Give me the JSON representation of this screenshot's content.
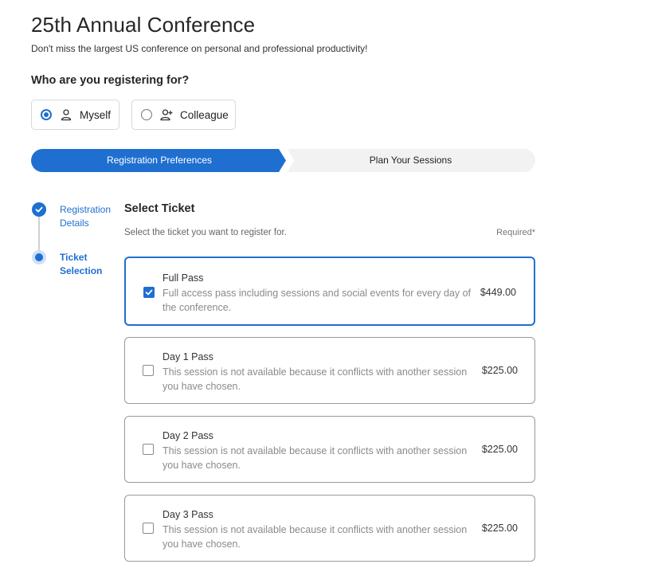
{
  "header": {
    "title": "25th Annual Conference",
    "subtitle": "Don't miss the largest US conference on personal and professional productivity!"
  },
  "who": {
    "question": "Who are you registering for?",
    "options": [
      {
        "label": "Myself",
        "icon": "person-icon",
        "selected": true
      },
      {
        "label": "Colleague",
        "icon": "person-add-icon",
        "selected": false
      }
    ]
  },
  "stepper": {
    "steps": [
      {
        "label": "Registration Preferences",
        "active": true
      },
      {
        "label": "Plan Your Sessions",
        "active": false
      }
    ]
  },
  "sidebar": {
    "steps": [
      {
        "label": "Registration Details",
        "status": "completed"
      },
      {
        "label": "Ticket Selection",
        "status": "current"
      }
    ]
  },
  "tickets": {
    "title": "Select Ticket",
    "hint": "Select the ticket you want to register for.",
    "required_label": "Required*",
    "items": [
      {
        "name": "Full Pass",
        "description": "Full access pass including sessions and social events for every day of the conference.",
        "price": "$449.00",
        "checked": true
      },
      {
        "name": "Day 1 Pass",
        "description": "This session is not available because it conflicts with another session you have chosen.",
        "price": "$225.00",
        "checked": false
      },
      {
        "name": "Day 2 Pass",
        "description": "This session is not available because it conflicts with another session you have chosen.",
        "price": "$225.00",
        "checked": false
      },
      {
        "name": "Day 3 Pass",
        "description": "This session is not available because it conflicts with another session you have chosen.",
        "price": "$225.00",
        "checked": false
      }
    ]
  },
  "colors": {
    "accent": "#1f6fd1",
    "inactive_step": "#f2f2f2",
    "muted_text": "#8a8a8a"
  }
}
